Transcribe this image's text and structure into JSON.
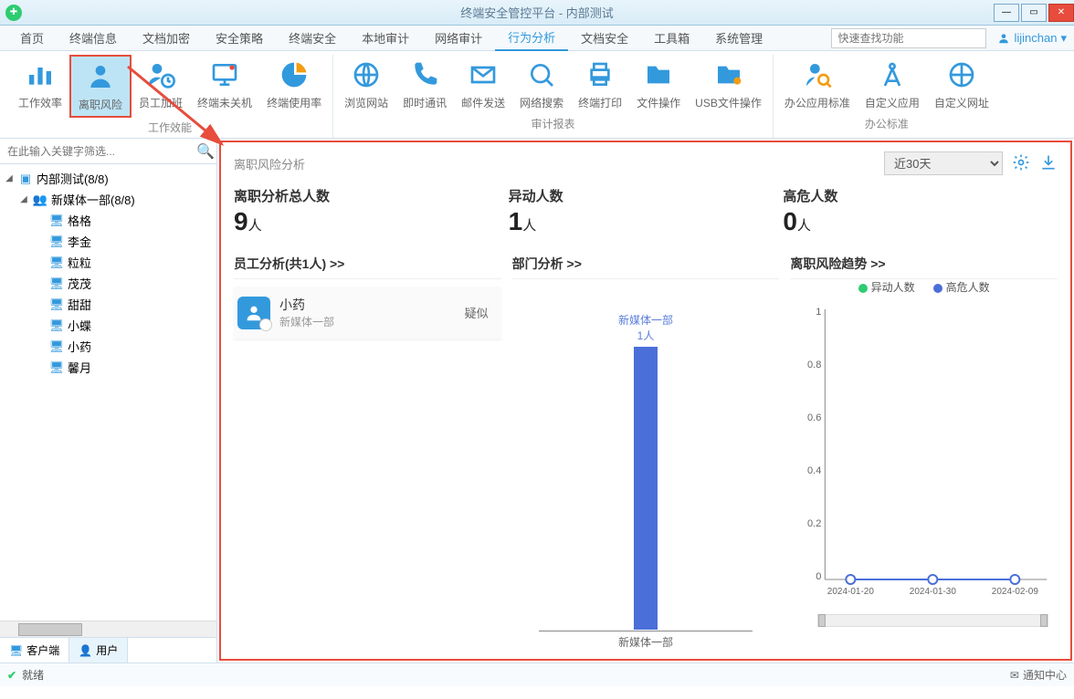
{
  "window": {
    "title": "终端安全管控平台 - 内部测试"
  },
  "menubar": {
    "items": [
      "首页",
      "终端信息",
      "文档加密",
      "安全策略",
      "终端安全",
      "本地审计",
      "网络审计",
      "行为分析",
      "文档安全",
      "工具箱",
      "系统管理"
    ],
    "active_index": 7,
    "search_placeholder": "快速查找功能",
    "user": "lijinchan"
  },
  "ribbon": {
    "groups": [
      {
        "label": "工作效能",
        "items": [
          {
            "label": "工作效率",
            "icon": "bars"
          },
          {
            "label": "离职风险",
            "icon": "person",
            "selected": true
          },
          {
            "label": "员工加班",
            "icon": "person-clock"
          },
          {
            "label": "终端未关机",
            "icon": "monitor"
          },
          {
            "label": "终端使用率",
            "icon": "pie"
          }
        ]
      },
      {
        "label": "审计报表",
        "items": [
          {
            "label": "浏览网站",
            "icon": "globe"
          },
          {
            "label": "即时通讯",
            "icon": "phone"
          },
          {
            "label": "邮件发送",
            "icon": "mail"
          },
          {
            "label": "网络搜索",
            "icon": "search-globe"
          },
          {
            "label": "终端打印",
            "icon": "printer"
          },
          {
            "label": "文件操作",
            "icon": "folder"
          },
          {
            "label": "USB文件操作",
            "icon": "usb"
          }
        ]
      },
      {
        "label": "办公标准",
        "items": [
          {
            "label": "办公应用标准",
            "icon": "person-search"
          },
          {
            "label": "自定义应用",
            "icon": "compass"
          },
          {
            "label": "自定义网址",
            "icon": "globe2"
          }
        ]
      }
    ]
  },
  "sidebar": {
    "search_placeholder": "在此输入关键字筛选...",
    "root": {
      "label": "内部测试(8/8)"
    },
    "group": {
      "label": "新媒体一部(8/8)"
    },
    "members": [
      "格格",
      "李金",
      "粒粒",
      "茂茂",
      "甜甜",
      "小蝶",
      "小药",
      "馨月"
    ],
    "tabs": {
      "client": "客户端",
      "user": "用户"
    }
  },
  "content": {
    "header": {
      "title": "离职风险分析",
      "range": "近30天"
    },
    "stats": [
      {
        "label": "离职分析总人数",
        "value": "9",
        "unit": "人"
      },
      {
        "label": "异动人数",
        "value": "1",
        "unit": "人"
      },
      {
        "label": "高危人数",
        "value": "0",
        "unit": "人"
      }
    ],
    "emp_panel": {
      "title": "员工分析(共1人) >>",
      "employee": {
        "name": "小药",
        "dept": "新媒体一部",
        "tag": "疑似"
      }
    },
    "dept_panel": {
      "title": "部门分析 >>",
      "bar": {
        "label": "新媒体一部",
        "count": "1人"
      },
      "xlabel": "新媒体一部"
    },
    "trend_panel": {
      "title": "离职风险趋势 >>",
      "legend": {
        "a": "异动人数",
        "b": "高危人数"
      },
      "xticks": [
        "2024-01-20",
        "2024-01-30",
        "2024-02-09"
      ]
    }
  },
  "chart_data": [
    {
      "type": "bar",
      "title": "部门分析",
      "categories": [
        "新媒体一部"
      ],
      "values": [
        1
      ],
      "xlabel": "新媒体一部",
      "ylabel": "",
      "ylim": [
        0,
        1
      ]
    },
    {
      "type": "line",
      "title": "离职风险趋势",
      "x": [
        "2024-01-20",
        "2024-01-30",
        "2024-02-09"
      ],
      "series": [
        {
          "name": "异动人数",
          "values": [
            0,
            0,
            0
          ],
          "color": "#2ecc71"
        },
        {
          "name": "高危人数",
          "values": [
            0,
            0,
            0
          ],
          "color": "#4b6fd9"
        }
      ],
      "ylim": [
        0,
        1
      ],
      "yticks": [
        0,
        0.2,
        0.4,
        0.6,
        0.8,
        1
      ]
    }
  ],
  "statusbar": {
    "status": "就绪",
    "notif": "通知中心"
  }
}
